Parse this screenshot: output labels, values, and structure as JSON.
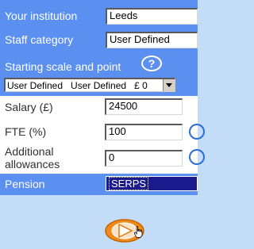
{
  "form": {
    "institution_label": "Your institution",
    "institution_value": "Leeds",
    "staff_category_label": "Staff category",
    "staff_category_value": "User Defined",
    "scale_label": "Starting scale and point",
    "help_symbol": "?",
    "scale_selected": "User Defined   User Defined   £ 0",
    "salary_label": "Salary (£)",
    "salary_value": "24500",
    "fte_label": "FTE (%)",
    "fte_value": "100",
    "allowances_label_line1": "Additional",
    "allowances_label_line2": "allowances",
    "allowances_value": "0",
    "pension_label": "Pension",
    "pension_value": "SERPS"
  },
  "icons": {
    "help": "question-circle-icon",
    "play": "play-button-icon",
    "cursor": "hand-pointer-icon",
    "dropdown": "dropdown-arrow-icon"
  },
  "colors": {
    "panel_blue": "#5b8ff0",
    "page_bg": "#c3dcf8",
    "pension_selected": "#1a1a8c",
    "play_orange": "#f28a1a"
  }
}
